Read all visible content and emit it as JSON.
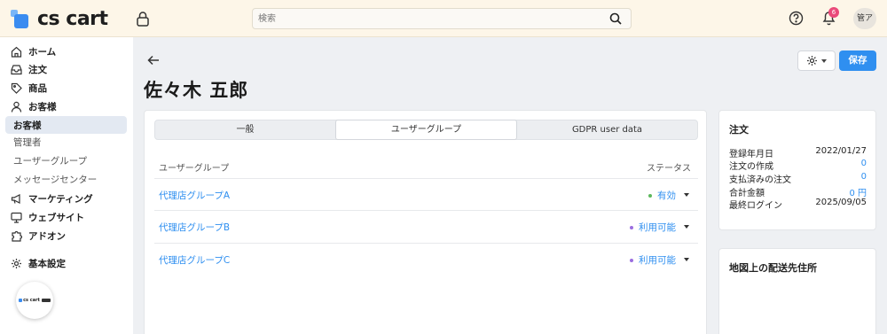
{
  "header": {
    "logo_text": "cs cart",
    "search_placeholder": "検索",
    "notification_count": "6",
    "user_initials": "管ア"
  },
  "sidebar": {
    "items": [
      {
        "label": "ホーム",
        "icon": "home-icon"
      },
      {
        "label": "注文",
        "icon": "inbox-icon"
      },
      {
        "label": "商品",
        "icon": "tag-icon"
      },
      {
        "label": "お客様",
        "icon": "user-icon"
      }
    ],
    "active_label": "お客様",
    "sub_items": [
      "管理者",
      "ユーザーグループ",
      "メッセージセンター"
    ],
    "items_after": [
      {
        "label": "マーケティング",
        "icon": "megaphone-icon"
      },
      {
        "label": "ウェブサイト",
        "icon": "monitor-icon"
      },
      {
        "label": "アドオン",
        "icon": "puzzle-icon"
      }
    ],
    "settings_label": "基本設定",
    "fab_text": "cs cart"
  },
  "page": {
    "title": "佐々木 五郎",
    "save_label": "保存"
  },
  "tabs": [
    {
      "label": "一般",
      "active": false
    },
    {
      "label": "ユーザーグループ",
      "active": true
    },
    {
      "label": "GDPR user data",
      "active": false
    }
  ],
  "table": {
    "col_group": "ユーザーグループ",
    "col_status": "ステータス",
    "rows": [
      {
        "name": "代理店グループA",
        "status": "有効",
        "dot_color": "#5cb85c"
      },
      {
        "name": "代理店グループB",
        "status": "利用可能",
        "dot_color": "#9b6ee0"
      },
      {
        "name": "代理店グループC",
        "status": "利用可能",
        "dot_color": "#9b6ee0"
      }
    ]
  },
  "order_panel": {
    "title": "注文",
    "rows": [
      {
        "label": "登録年月日",
        "value": "2022/01/27",
        "link": false
      },
      {
        "label": "注文の作成",
        "value": "0",
        "link": true
      },
      {
        "label": "支払済みの注文",
        "value": "0",
        "link": true
      },
      {
        "label": "合計金額",
        "value": "0 円",
        "link": true
      },
      {
        "label": "最終ログイン",
        "value": "2025/09/05",
        "link": false
      }
    ]
  },
  "map_panel": {
    "title": "地図上の配送先住所"
  },
  "colors": {
    "accent": "#2f8ff0",
    "header_bg": "#fdf6e8",
    "badge": "#ea4a7a"
  }
}
